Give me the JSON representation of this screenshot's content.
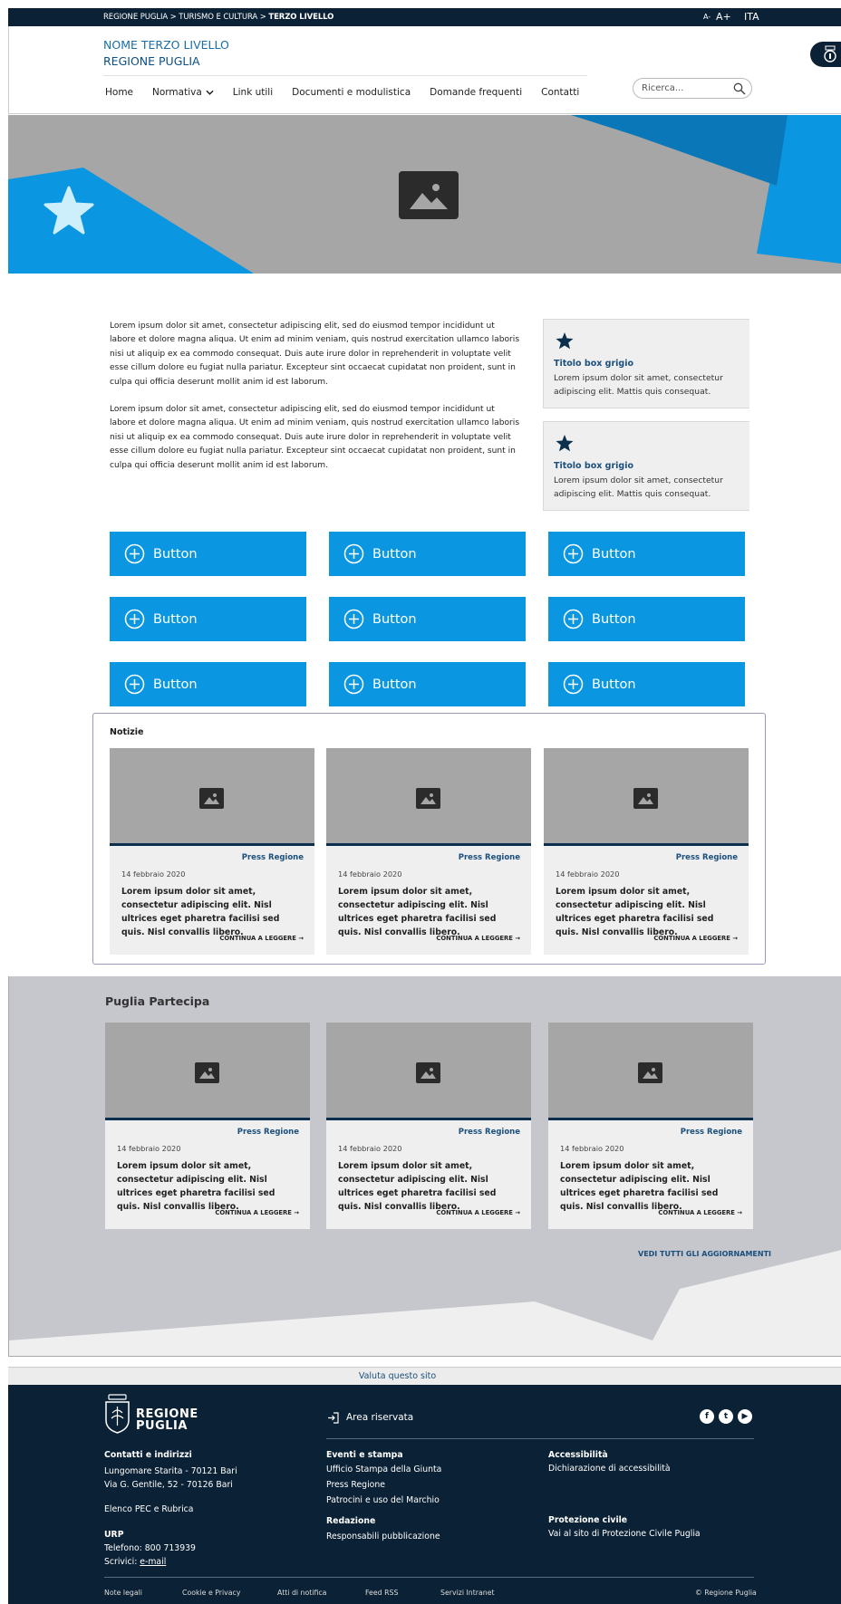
{
  "topbar": {
    "breadcrumb_prefix": "REGIONE PUGLIA > TURISMO E CULTURA > ",
    "breadcrumb_current": "TERZO LIVELLO",
    "font_decrease": "A-",
    "font_increase": "A+",
    "language": "ITA"
  },
  "header": {
    "site_line1": "NOME TERZO LIVELLO",
    "site_line2": "REGIONE PUGLIA",
    "nav": [
      "Home",
      "Normativa",
      "Link utili",
      "Documenti e modulistica",
      "Domande frequenti",
      "Contatti"
    ],
    "search_placeholder": "Ricerca..."
  },
  "content": {
    "paragraph1": "Lorem ipsum dolor sit amet, consectetur adipiscing elit, sed do eiusmod tempor incididunt ut labore et dolore magna aliqua. Ut enim ad minim veniam, quis nostrud exercitation ullamco laboris nisi ut aliquip ex ea commodo consequat. Duis aute irure dolor in reprehenderit in voluptate velit esse cillum dolore eu fugiat nulla pariatur. Excepteur sint occaecat cupidatat non proident, sunt in culpa qui officia deserunt mollit anim id est laborum.",
    "paragraph2": "Lorem ipsum dolor sit amet, consectetur adipiscing elit, sed do eiusmod tempor incididunt ut labore et dolore magna aliqua. Ut enim ad minim veniam, quis nostrud exercitation ullamco laboris nisi ut aliquip ex ea commodo consequat. Duis aute irure dolor in reprehenderit in voluptate velit esse cillum dolore eu fugiat nulla pariatur. Excepteur sint occaecat cupidatat non proident, sunt in culpa qui officia deserunt mollit anim id est laborum.",
    "boxes": [
      {
        "title": "Titolo box grigio",
        "text": "Lorem ipsum dolor sit amet, consectetur adipiscing elit. Mattis quis consequat."
      },
      {
        "title": "Titolo box grigio",
        "text": "Lorem ipsum dolor sit amet, consectetur adipiscing elit. Mattis quis consequat."
      }
    ]
  },
  "buttons": {
    "label": "Button"
  },
  "news": {
    "title": "Notizie",
    "cards": [
      {
        "category": "Press Regione",
        "date": "14 febbraio 2020",
        "text": "Lorem ipsum dolor sit amet, consectetur adipiscing elit. Nisl ultrices eget pharetra facilisi sed quis. Nisl convallis libero.",
        "more": "CONTINUA A LEGGERE"
      },
      {
        "category": "Press Regione",
        "date": "14 febbraio 2020",
        "text": "Lorem ipsum dolor sit amet, consectetur adipiscing elit. Nisl ultrices eget pharetra facilisi sed quis. Nisl convallis libero.",
        "more": "CONTINUA A LEGGERE"
      },
      {
        "category": "Press Regione",
        "date": "14 febbraio 2020",
        "text": "Lorem ipsum dolor sit amet, consectetur adipiscing elit. Nisl ultrices eget pharetra facilisi sed quis. Nisl convallis libero.",
        "more": "CONTINUA A LEGGERE"
      }
    ]
  },
  "partecipa": {
    "title": "Puglia Partecipa",
    "see_all": "VEDI TUTTI GLI AGGIORNAMENTI",
    "cards": [
      {
        "category": "Press Regione",
        "date": "14 febbraio 2020",
        "text": "Lorem ipsum dolor sit amet, consectetur adipiscing elit. Nisl ultrices eget pharetra facilisi sed quis. Nisl convallis libero.",
        "more": "CONTINUA A LEGGERE"
      },
      {
        "category": "Press Regione",
        "date": "14 febbraio 2020",
        "text": "Lorem ipsum dolor sit amet, consectetur adipiscing elit. Nisl ultrices eget pharetra facilisi sed quis. Nisl convallis libero.",
        "more": "CONTINUA A LEGGERE"
      },
      {
        "category": "Press Regione",
        "date": "14 febbraio 2020",
        "text": "Lorem ipsum dolor sit amet, consectetur adipiscing elit. Nisl ultrices eget pharetra facilisi sed quis. Nisl convallis libero.",
        "more": "CONTINUA A LEGGERE"
      }
    ]
  },
  "valuta": "Valuta questo sito",
  "footer": {
    "logo_line1": "REGIONE",
    "logo_line2": "PUGLIA",
    "reserved_area": "Area riservata",
    "contacts_title": "Contatti e indirizzi",
    "address1": "Lungomare Starita - 70121 Bari",
    "address2": "Via G. Gentile, 52 - 70126 Bari",
    "pec": "Elenco PEC e Rubrica",
    "urp_title": "URP",
    "phone": "Telefono: 800 713939",
    "write_prefix": "Scrivici: ",
    "email": "e-mail",
    "events_title": "Eventi e stampa",
    "events_items": [
      "Ufficio Stampa della Giunta",
      "Press Regione",
      "Patrocini e uso del Marchio"
    ],
    "redazione_title": "Redazione",
    "redazione_item": "Responsabili pubblicazione",
    "access_title": "Accessibilità",
    "access_item": "Dichiarazione di accessibilità",
    "civil_title": "Protezione civile",
    "civil_item": "Vai al sito di Protezione Civile Puglia",
    "bottom_links": [
      "Note legali",
      "Cookie e Privacy",
      "Atti di notifica",
      "Feed RSS",
      "Servizi Intranet"
    ],
    "copyright": "© Regione Puglia",
    "social": [
      "facebook-icon",
      "twitter-icon",
      "youtube-icon"
    ]
  },
  "colors": {
    "primary_blue": "#0a96e1",
    "dark_navy": "#0b2135",
    "link_blue": "#1b4f7c",
    "hero_grey": "#a6a6a6"
  }
}
